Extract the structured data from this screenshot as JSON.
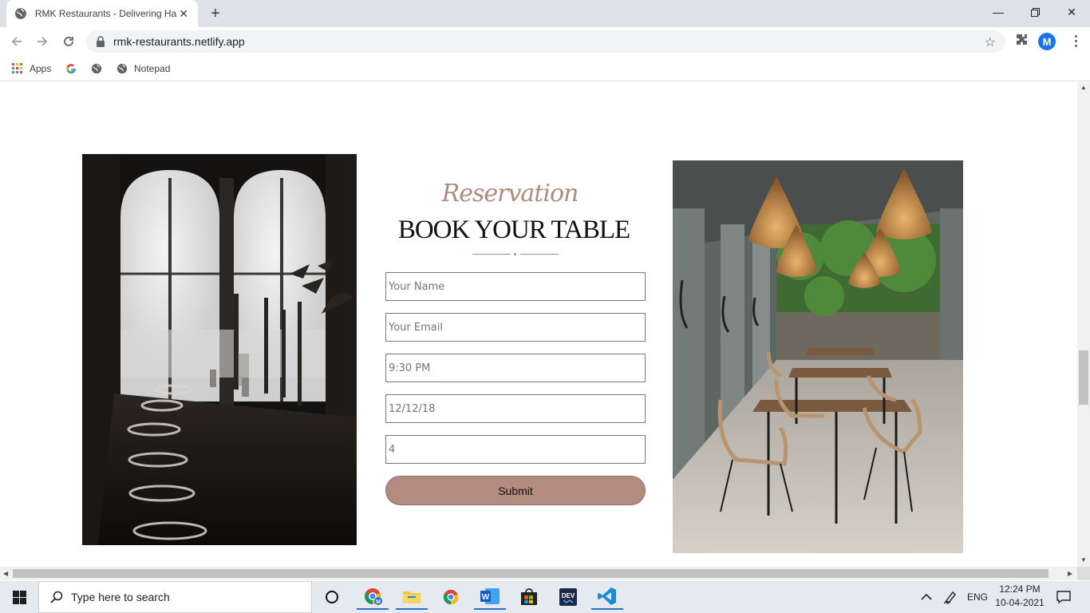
{
  "browser": {
    "tab_title": "RMK Restaurants - Delivering Ha",
    "url": "rmk-restaurants.netlify.app",
    "profile_initial": "M",
    "bookmarks": [
      {
        "label": "Apps"
      },
      {
        "label": ""
      },
      {
        "label": ""
      },
      {
        "label": "Notepad"
      }
    ]
  },
  "page": {
    "script_heading": "Reservation",
    "heading": "BOOK YOUR TABLE",
    "accent_color": "#b48b7f",
    "form": {
      "name_placeholder": "Your Name",
      "email_placeholder": "Your Email",
      "time_placeholder": "9:30 PM",
      "date_placeholder": "12/12/18",
      "guests_placeholder": "4",
      "submit_label": "Submit"
    }
  },
  "taskbar": {
    "search_placeholder": "Type here to search",
    "language": "ENG",
    "time": "12:24 PM",
    "date": "10-04-2021"
  }
}
